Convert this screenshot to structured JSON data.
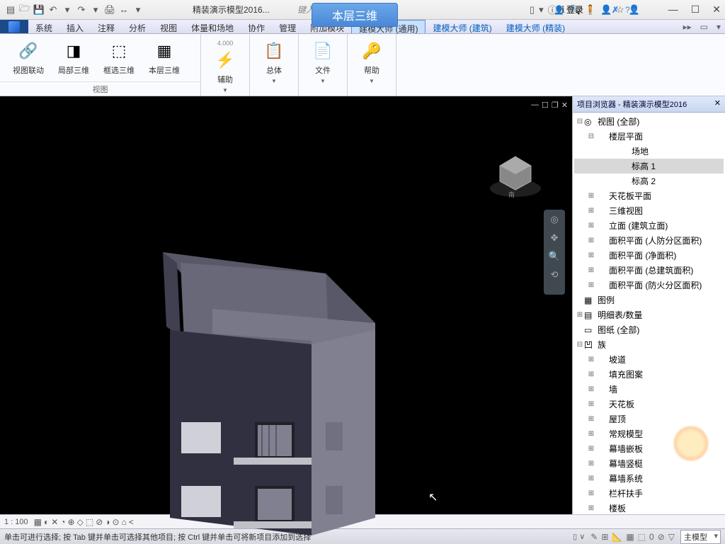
{
  "title": "精装演示模型2016...",
  "banner": "本层三维",
  "qat_icons": [
    "▤",
    "🗁",
    "💾",
    "↶",
    "▾",
    "↷",
    "▾",
    "🖨",
    "↔",
    "▾"
  ],
  "login_label": "登录",
  "right_tools": [
    "▯",
    "▾",
    "ⓘ",
    "ℹ",
    "🔍",
    "🧍",
    "👤",
    "☆",
    "👤"
  ],
  "winctl": [
    "—",
    "☐",
    "✕"
  ],
  "menu_tabs": [
    "系统",
    "插入",
    "注释",
    "分析",
    "视图",
    "体量和场地",
    "协作",
    "管理",
    "附加模块"
  ],
  "active_tab": "建模大师 (通用)",
  "sec_tabs": [
    "建模大师 (建筑)",
    "建模大师 (精装)"
  ],
  "ext_icons": [
    "▸▸",
    "▭",
    "▾"
  ],
  "ribbon": {
    "panel1": {
      "label": "视图",
      "items": [
        {
          "txt": "视图联动",
          "ico": "🔗"
        },
        {
          "txt": "局部三维",
          "ico": "◨"
        },
        {
          "txt": "框选三维",
          "ico": "⬚"
        },
        {
          "txt": "本层三维",
          "ico": "▦"
        }
      ]
    },
    "others": [
      {
        "txt": "辅助",
        "ico": "⚡",
        "sub": "4.000"
      },
      {
        "txt": "总体",
        "ico": "📋"
      },
      {
        "txt": "文件",
        "ico": "📄"
      },
      {
        "txt": "帮助",
        "ico": "🔑"
      }
    ]
  },
  "browser_title": "项目浏览器 - 精装演示模型2016",
  "tree": [
    {
      "ind": 0,
      "exp": "⊟",
      "ico": "◎",
      "txt": "视图 (全部)"
    },
    {
      "ind": 1,
      "exp": "⊟",
      "ico": "",
      "txt": "楼层平面"
    },
    {
      "ind": 3,
      "exp": "",
      "ico": "",
      "txt": "场地"
    },
    {
      "ind": 3,
      "exp": "",
      "ico": "",
      "txt": "标高 1",
      "sel": true
    },
    {
      "ind": 3,
      "exp": "",
      "ico": "",
      "txt": "标高 2"
    },
    {
      "ind": 1,
      "exp": "⊞",
      "ico": "",
      "txt": "天花板平面"
    },
    {
      "ind": 1,
      "exp": "⊞",
      "ico": "",
      "txt": "三维视图"
    },
    {
      "ind": 1,
      "exp": "⊞",
      "ico": "",
      "txt": "立面 (建筑立面)"
    },
    {
      "ind": 1,
      "exp": "⊞",
      "ico": "",
      "txt": "面积平面 (人防分区面积)"
    },
    {
      "ind": 1,
      "exp": "⊞",
      "ico": "",
      "txt": "面积平面 (净面积)"
    },
    {
      "ind": 1,
      "exp": "⊞",
      "ico": "",
      "txt": "面积平面 (总建筑面积)"
    },
    {
      "ind": 1,
      "exp": "⊞",
      "ico": "",
      "txt": "面积平面 (防火分区面积)"
    },
    {
      "ind": 0,
      "exp": "",
      "ico": "▦",
      "txt": "图例"
    },
    {
      "ind": 0,
      "exp": "⊞",
      "ico": "▤",
      "txt": "明细表/数量"
    },
    {
      "ind": 0,
      "exp": "",
      "ico": "▭",
      "txt": "图纸 (全部)"
    },
    {
      "ind": 0,
      "exp": "⊟",
      "ico": "凹",
      "txt": "族"
    },
    {
      "ind": 1,
      "exp": "⊞",
      "ico": "",
      "txt": "坡道"
    },
    {
      "ind": 1,
      "exp": "⊞",
      "ico": "",
      "txt": "填充图案"
    },
    {
      "ind": 1,
      "exp": "⊞",
      "ico": "",
      "txt": "墙"
    },
    {
      "ind": 1,
      "exp": "⊞",
      "ico": "",
      "txt": "天花板"
    },
    {
      "ind": 1,
      "exp": "⊞",
      "ico": "",
      "txt": "屋顶"
    },
    {
      "ind": 1,
      "exp": "⊞",
      "ico": "",
      "txt": "常规模型"
    },
    {
      "ind": 1,
      "exp": "⊞",
      "ico": "",
      "txt": "幕墙嵌板"
    },
    {
      "ind": 1,
      "exp": "⊞",
      "ico": "",
      "txt": "幕墙竖梃"
    },
    {
      "ind": 1,
      "exp": "⊞",
      "ico": "",
      "txt": "幕墙系统"
    },
    {
      "ind": 1,
      "exp": "⊞",
      "ico": "",
      "txt": "栏杆扶手"
    },
    {
      "ind": 1,
      "exp": "⊞",
      "ico": "",
      "txt": "楼板"
    }
  ],
  "viewbar": {
    "scale": "1 : 100",
    "icons": [
      "▦",
      "◐",
      "✕",
      "◔",
      "⊕",
      "◇",
      "⬚",
      "⊘",
      "◑",
      "⊙",
      "⌂",
      "<"
    ]
  },
  "status": {
    "msg": "单击可进行选择; 按 Tab 键并单击可选择其他项目; 按 Ctrl 键并单击可将新项目添加到选择",
    "icons": [
      "✎",
      "⊞",
      "📐",
      "▦",
      "⬚",
      "0",
      "⊘",
      "▽"
    ],
    "combo": "主模型"
  }
}
